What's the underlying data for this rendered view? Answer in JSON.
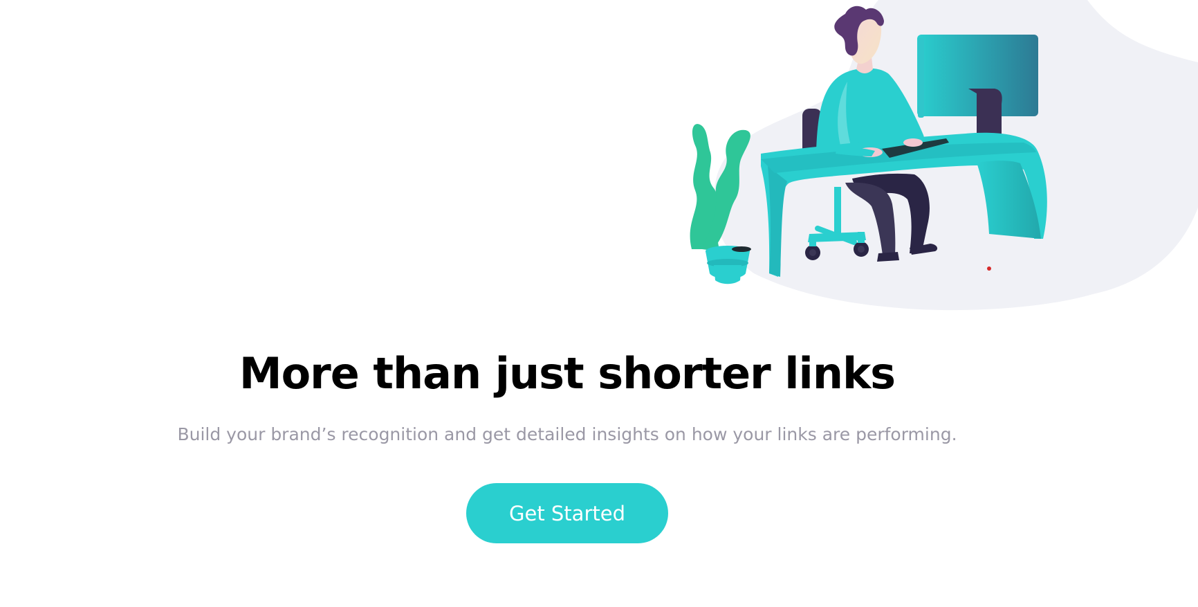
{
  "hero": {
    "title": "More than just shorter links",
    "subtitle": "Build your brand’s recognition and get detailed insights on how your links are performing.",
    "cta_label": "Get Started"
  },
  "colors": {
    "accent": "#2acfcf",
    "title": "#000000",
    "subtitle": "#9a98a5",
    "blob": "#f0f1f6",
    "plant": "#2fc698",
    "dark": "#3b3054"
  }
}
